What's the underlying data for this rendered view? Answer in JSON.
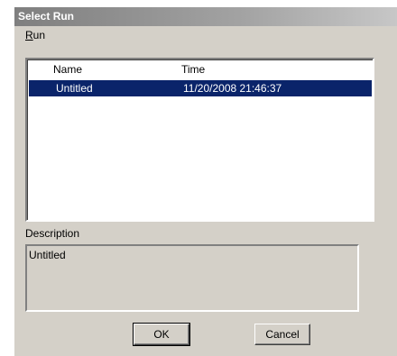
{
  "window": {
    "title": "Select Run"
  },
  "menu": {
    "run_prefix": "",
    "run_underlined": "R",
    "run_rest": "un"
  },
  "list": {
    "columns": [
      "Name",
      "Time"
    ],
    "rows": [
      {
        "name": "Untitled",
        "time": "11/20/2008 21:46:37",
        "selected": true
      }
    ]
  },
  "description": {
    "label": "Description",
    "text": "Untitled"
  },
  "buttons": {
    "ok": "OK",
    "cancel": "Cancel"
  },
  "colors": {
    "selection": "#0a246a",
    "face": "#d4d0c8"
  }
}
